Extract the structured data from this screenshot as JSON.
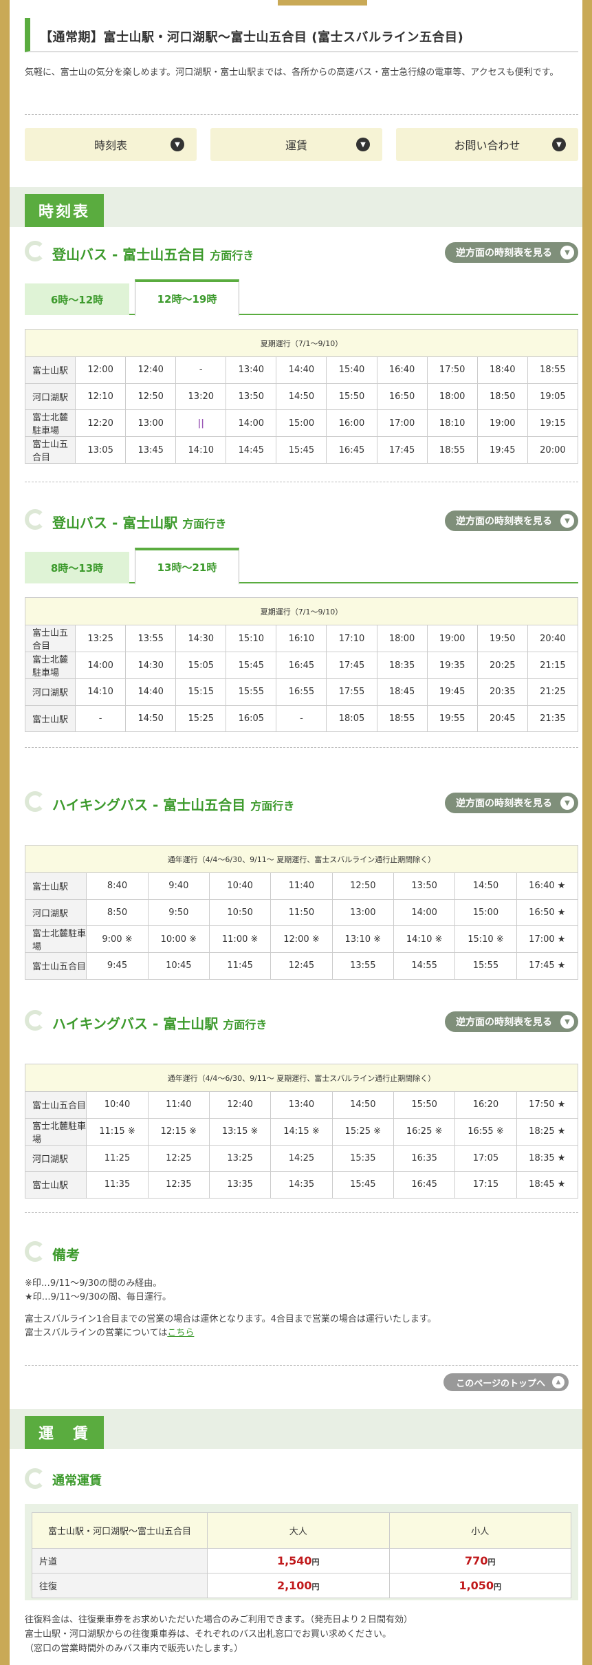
{
  "header": {
    "title": "【通常期】富士山駅・河口湖駅～富士山五合目 (富士スバルライン五合目)",
    "intro": "気軽に、富士山の気分を楽しめます。河口湖駅・富士山駅までは、各所からの高速バス・富士急行線の電車等、アクセスも便利です。"
  },
  "jump_links": [
    {
      "label": "時刻表",
      "icon": "chevron-down-icon"
    },
    {
      "label": "運賃",
      "icon": "chevron-down-icon"
    },
    {
      "label": "お問い合わせ",
      "icon": "chevron-down-icon"
    }
  ],
  "sections": {
    "timetable_tag": "時刻表",
    "fare_tag": "運　賃"
  },
  "reverse_button_label": "逆方面の時刻表を見る",
  "route1": {
    "title": "登山バス - 富士山五合目",
    "suffix": "方面行き",
    "tabs": [
      "6時～12時",
      "12時～19時"
    ],
    "active_tab": 1,
    "caption": "夏期運行（7/1～9/10）",
    "rows": [
      {
        "station": "富士山駅",
        "times": [
          "12:00",
          "12:40",
          "-",
          "13:40",
          "14:40",
          "15:40",
          "16:40",
          "17:50",
          "18:40",
          "18:55"
        ]
      },
      {
        "station": "河口湖駅",
        "times": [
          "12:10",
          "12:50",
          "13:20",
          "13:50",
          "14:50",
          "15:50",
          "16:50",
          "18:00",
          "18:50",
          "19:05"
        ]
      },
      {
        "station": "富士北麓駐車場",
        "times": [
          "12:20",
          "13:00",
          "||",
          "14:00",
          "15:00",
          "16:00",
          "17:00",
          "18:10",
          "19:00",
          "19:15"
        ]
      },
      {
        "station": "富士山五合目",
        "times": [
          "13:05",
          "13:45",
          "14:10",
          "14:45",
          "15:45",
          "16:45",
          "17:45",
          "18:55",
          "19:45",
          "20:00"
        ]
      }
    ]
  },
  "route2": {
    "title": "登山バス - 富士山駅",
    "suffix": "方面行き",
    "tabs": [
      "8時～13時",
      "13時～21時"
    ],
    "active_tab": 1,
    "caption": "夏期運行（7/1～9/10）",
    "rows": [
      {
        "station": "富士山五合目",
        "times": [
          "13:25",
          "13:55",
          "14:30",
          "15:10",
          "16:10",
          "17:10",
          "18:00",
          "19:00",
          "19:50",
          "20:40"
        ]
      },
      {
        "station": "富士北麓駐車場",
        "times": [
          "14:00",
          "14:30",
          "15:05",
          "15:45",
          "16:45",
          "17:45",
          "18:35",
          "19:35",
          "20:25",
          "21:15"
        ]
      },
      {
        "station": "河口湖駅",
        "times": [
          "14:10",
          "14:40",
          "15:15",
          "15:55",
          "16:55",
          "17:55",
          "18:45",
          "19:45",
          "20:35",
          "21:25"
        ]
      },
      {
        "station": "富士山駅",
        "times": [
          "-",
          "14:50",
          "15:25",
          "16:05",
          "-",
          "18:05",
          "18:55",
          "19:55",
          "20:45",
          "21:35"
        ]
      }
    ]
  },
  "route3": {
    "title": "ハイキングバス - 富士山五合目",
    "suffix": "方面行き",
    "caption": "通年運行（4/4～6/30、9/11～ 夏期運行、富士スバルライン通行止期間除く）",
    "rows": [
      {
        "station": "富士山駅",
        "times": [
          "8:40",
          "9:40",
          "10:40",
          "11:40",
          "12:50",
          "13:50",
          "14:50",
          "16:40 ★"
        ]
      },
      {
        "station": "河口湖駅",
        "times": [
          "8:50",
          "9:50",
          "10:50",
          "11:50",
          "13:00",
          "14:00",
          "15:00",
          "16:50 ★"
        ]
      },
      {
        "station": "富士北麓駐車場",
        "times": [
          "9:00 ※",
          "10:00 ※",
          "11:00 ※",
          "12:00 ※",
          "13:10 ※",
          "14:10 ※",
          "15:10 ※",
          "17:00 ★"
        ]
      },
      {
        "station": "富士山五合目",
        "times": [
          "9:45",
          "10:45",
          "11:45",
          "12:45",
          "13:55",
          "14:55",
          "15:55",
          "17:45 ★"
        ]
      }
    ]
  },
  "route4": {
    "title": "ハイキングバス - 富士山駅",
    "suffix": "方面行き",
    "caption": "通年運行（4/4～6/30、9/11～ 夏期運行、富士スバルライン通行止期間除く）",
    "rows": [
      {
        "station": "富士山五合目",
        "times": [
          "10:40",
          "11:40",
          "12:40",
          "13:40",
          "14:50",
          "15:50",
          "16:20",
          "17:50 ★"
        ]
      },
      {
        "station": "富士北麓駐車場",
        "times": [
          "11:15 ※",
          "12:15 ※",
          "13:15 ※",
          "14:15 ※",
          "15:25 ※",
          "16:25 ※",
          "16:55 ※",
          "18:25 ★"
        ]
      },
      {
        "station": "河口湖駅",
        "times": [
          "11:25",
          "12:25",
          "13:25",
          "14:25",
          "15:35",
          "16:35",
          "17:05",
          "18:35 ★"
        ]
      },
      {
        "station": "富士山駅",
        "times": [
          "11:35",
          "12:35",
          "13:35",
          "14:35",
          "15:45",
          "16:45",
          "17:15",
          "18:45 ★"
        ]
      }
    ]
  },
  "remarks": {
    "title": "備考",
    "line1": "※印…9/11～9/30の間のみ経由。",
    "line2": "★印…9/11～9/30の間、毎日運行。",
    "line3": "富士スバルライン1合目までの営業の場合は運休となります。4合目まで営業の場合は運行いたします。",
    "line4_prefix": "富士スバルラインの営業については",
    "line4_link": "こちら"
  },
  "to_top_label": "このページのトップへ",
  "fare": {
    "title": "通常運賃",
    "route_label": "富士山駅・河口湖駅～富士山五合目",
    "adult_label": "大人",
    "child_label": "小人",
    "rows": [
      {
        "type": "片道",
        "adult": "1,540",
        "child": "770"
      },
      {
        "type": "往復",
        "adult": "2,100",
        "child": "1,050"
      }
    ],
    "yen": "円",
    "note1": "往復料金は、往復乗車券をお求めいただいた場合のみご利用できます。（発売日より２日間有効）",
    "note2": "富士山駅・河口湖駅からの往復乗車券は、それぞれのバス出札窓口でお買い求めください。",
    "note3": "（窓口の営業時間外のみバス車内で販売いたします。）"
  }
}
